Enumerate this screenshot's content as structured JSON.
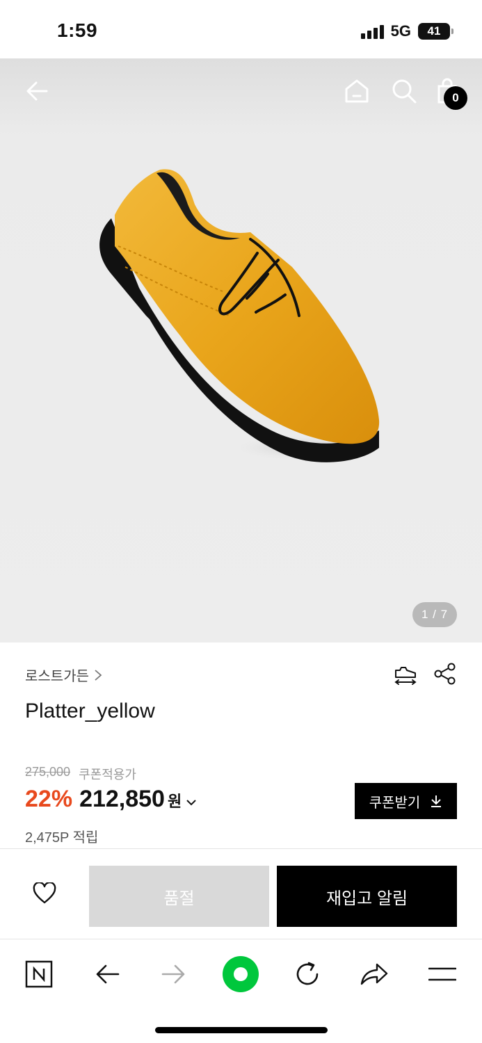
{
  "status_bar": {
    "time": "1:59",
    "network": "5G",
    "battery": "41"
  },
  "hero": {
    "page_indicator": "1 / 7",
    "cart_count": "0",
    "icons": [
      "back-arrow-icon",
      "home-icon",
      "search-icon",
      "shopping-bag-icon"
    ]
  },
  "product": {
    "brand": "로스트가든",
    "name": "Platter_yellow",
    "original_price": "275,000",
    "coupon_price_label": "쿠폰적용가",
    "discount": "22%",
    "price": "212,850",
    "currency": "원",
    "points": "2,475P 적립",
    "coupon_button": "쿠폰받기"
  },
  "actions": {
    "soldout_label": "품절",
    "restock_label": "재입고 알림"
  },
  "browser_toolbar": {
    "icons": [
      "naver-n-icon",
      "back-icon",
      "forward-icon",
      "green-dot-icon",
      "refresh-icon",
      "share-icon",
      "menu-icon"
    ]
  },
  "colors": {
    "discount": "#e8491d",
    "accent_green": "#00c73c",
    "primary": "#000000"
  }
}
